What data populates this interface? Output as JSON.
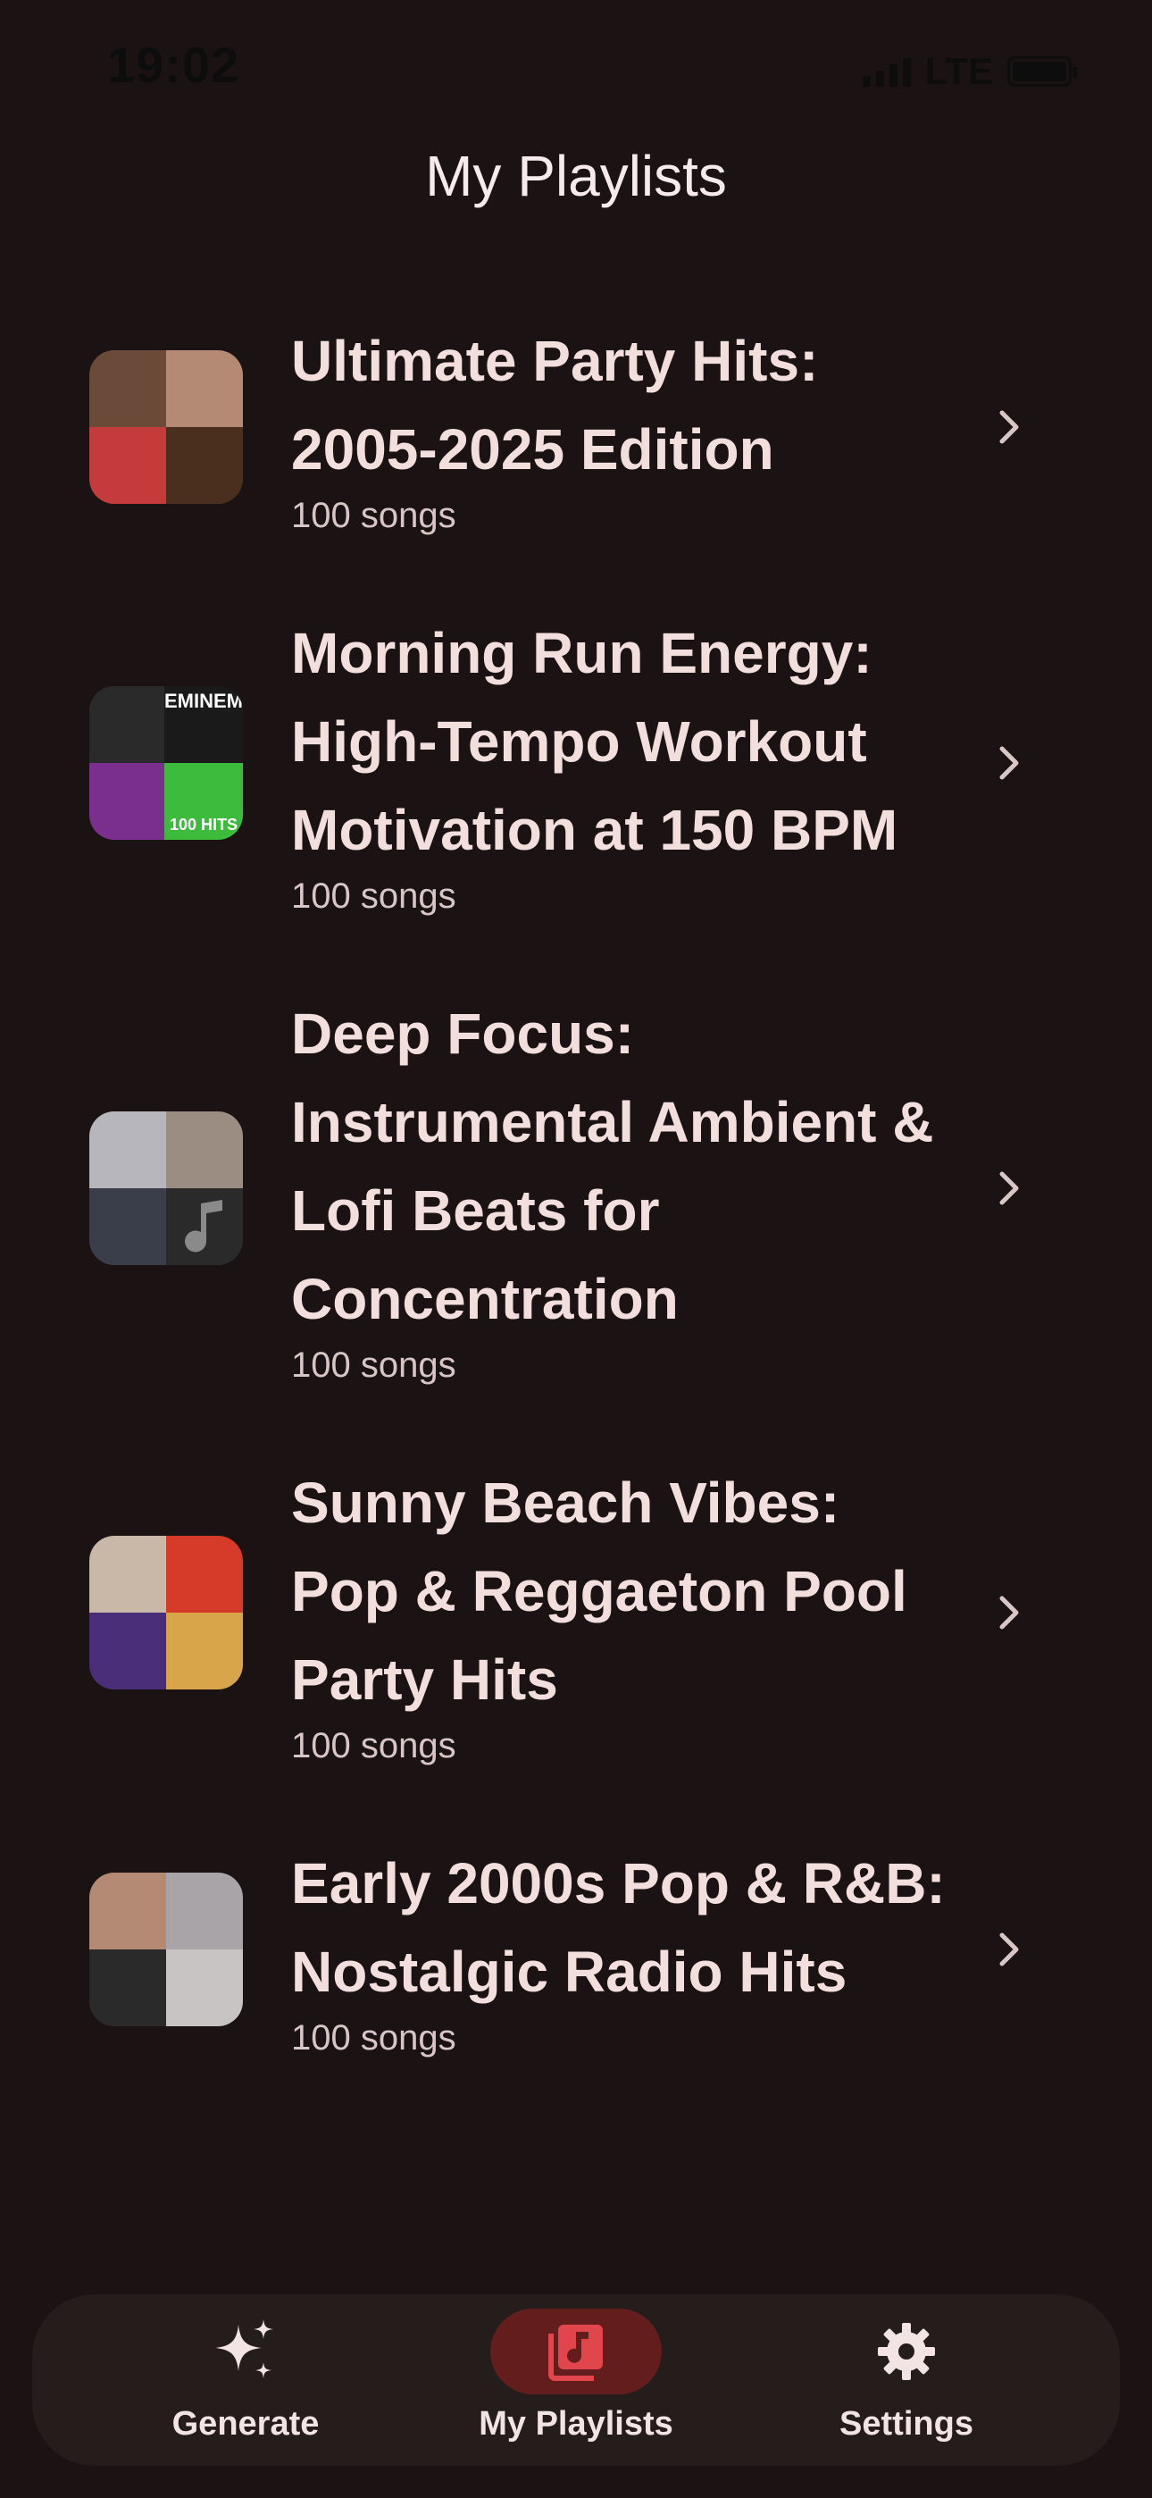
{
  "status_bar": {
    "time": "19:02",
    "network": "LTE"
  },
  "header": {
    "title": "My Playlists"
  },
  "playlists": [
    {
      "title": "Ultimate Party Hits: 2005-2025 Edition",
      "count": "100 songs",
      "cover_colors": [
        "#6b4a3a",
        "#b58a74",
        "#c53a3a",
        "#4a2e1e"
      ]
    },
    {
      "title": "Morning Run Energy: High-Tempo Workout Motivation at 150 BPM",
      "count": "100 songs",
      "cover_colors": [
        "#2a2a2a",
        "#1a1a1a",
        "#7a2f8f",
        "#3dbb3d"
      ]
    },
    {
      "title": "Deep Focus: Instrumental Ambient & Lofi Beats for Concentration",
      "count": "100 songs",
      "cover_colors": [
        "#b8b6bd",
        "#9c8d82",
        "#3a3d4a",
        "#2a2a2a"
      ]
    },
    {
      "title": "Sunny Beach Vibes: Pop & Reggaeton Pool Party Hits",
      "count": "100 songs",
      "cover_colors": [
        "#c9b7a8",
        "#d63a28",
        "#4a2e7a",
        "#d9a54a"
      ]
    },
    {
      "title": "Early 2000s Pop & R&B: Nostalgic Radio Hits",
      "count": "100 songs",
      "cover_colors": [
        "#b58a74",
        "#a8a4a8",
        "#2a2a2a",
        "#c9c4c4"
      ]
    }
  ],
  "cover_texts": {
    "morning_run_2": "EMINEM",
    "morning_run_4": "100 HITS"
  },
  "bottom_nav": {
    "items": [
      {
        "label": "Generate",
        "icon": "sparkles-icon",
        "active": false
      },
      {
        "label": "My Playlists",
        "icon": "music-library-icon",
        "active": true
      },
      {
        "label": "Settings",
        "icon": "gear-icon",
        "active": false
      }
    ],
    "active_bg": "#631d1d",
    "active_icon_color": "#e0464c"
  },
  "colors": {
    "background": "#1b1313",
    "text_primary": "#f3dede",
    "nav_bg": "#251c1c"
  }
}
